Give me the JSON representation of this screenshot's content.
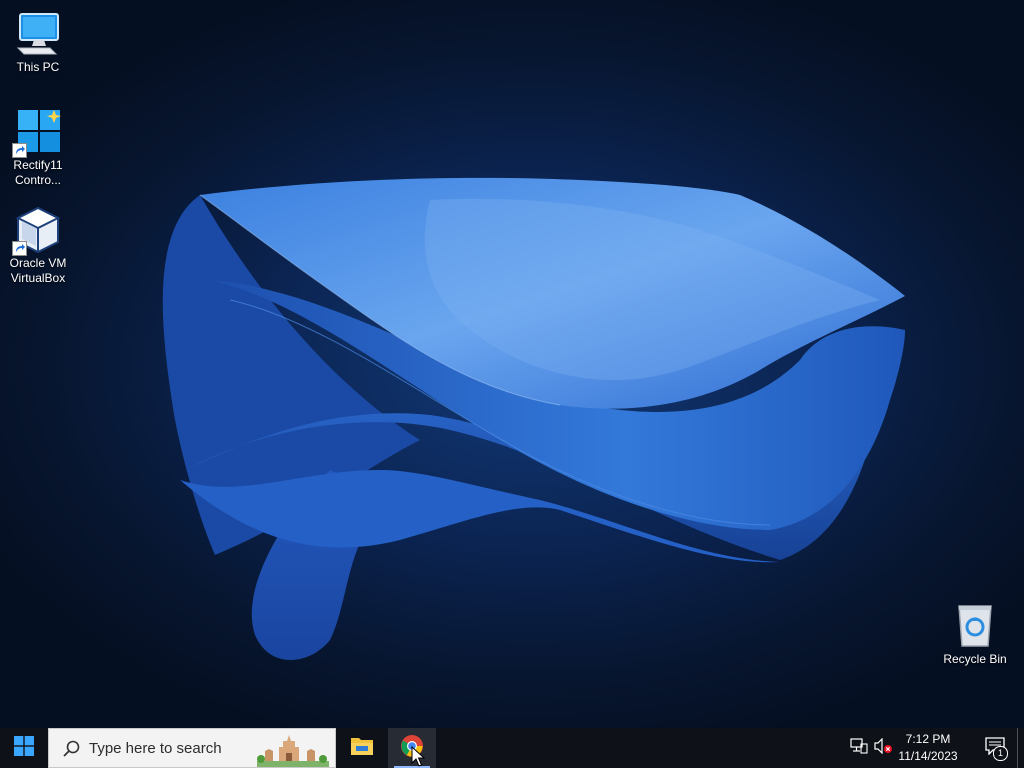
{
  "desktop": {
    "icons": [
      {
        "label": "This PC",
        "icon": "computer-icon"
      },
      {
        "label": "Rectify11\nContro...",
        "icon": "windows-logo-icon"
      },
      {
        "label": "Oracle VM\nVirtualBox",
        "icon": "virtualbox-icon"
      },
      {
        "label": "Recycle Bin",
        "icon": "recycle-bin-icon"
      }
    ]
  },
  "taskbar": {
    "search_placeholder": "Type here to search",
    "apps": [
      {
        "name": "File Explorer",
        "icon": "folder-icon"
      },
      {
        "name": "Google Chrome",
        "icon": "chrome-icon",
        "active": true
      }
    ],
    "clock": {
      "time": "7:12 PM",
      "date": "11/14/2023"
    },
    "notification_count": "1"
  },
  "colors": {
    "taskbar_bg": "#0e1117",
    "wallpaper_blue": "#2f6fd6",
    "search_bg": "#f3f3f3"
  }
}
